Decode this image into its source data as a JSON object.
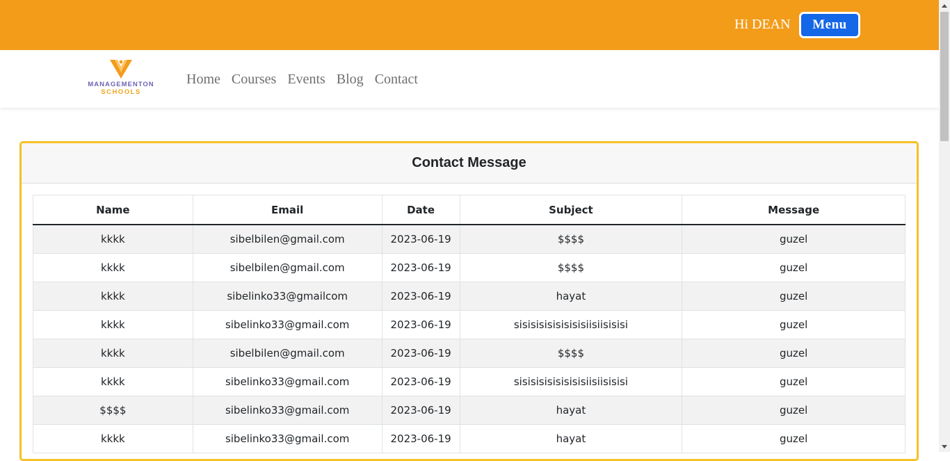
{
  "header": {
    "greeting": "Hi DEAN",
    "menu_label": "Menu",
    "accent_color": "#f39c1a",
    "menu_color": "#1467e6"
  },
  "logo": {
    "line1": "MANAGEMENTON",
    "line2": "SCHOOLS",
    "icon": "v-graduate-icon"
  },
  "nav": {
    "items": [
      "Home",
      "Courses",
      "Events",
      "Blog",
      "Contact"
    ]
  },
  "card": {
    "title": "Contact Message",
    "border_color": "#f6c026"
  },
  "table": {
    "headers": [
      "Name",
      "Email",
      "Date",
      "Subject",
      "Message"
    ],
    "rows": [
      [
        "kkkk",
        "sibelbilen@gmail.com",
        "2023-06-19",
        "$$$$",
        "guzel"
      ],
      [
        "kkkk",
        "sibelbilen@gmail.com",
        "2023-06-19",
        "$$$$",
        "guzel"
      ],
      [
        "kkkk",
        "sibelinko33@gmailcom",
        "2023-06-19",
        "hayat",
        "guzel"
      ],
      [
        "kkkk",
        "sibelinko33@gmail.com",
        "2023-06-19",
        "sisisisisisisisisiisiisisisi",
        "guzel"
      ],
      [
        "kkkk",
        "sibelbilen@gmail.com",
        "2023-06-19",
        "$$$$",
        "guzel"
      ],
      [
        "kkkk",
        "sibelinko33@gmail.com",
        "2023-06-19",
        "sisisisisisisisisiisiisisisi",
        "guzel"
      ],
      [
        "$$$$",
        "sibelinko33@gmail.com",
        "2023-06-19",
        "hayat",
        "guzel"
      ],
      [
        "kkkk",
        "sibelinko33@gmail.com",
        "2023-06-19",
        "hayat",
        "guzel"
      ]
    ]
  }
}
